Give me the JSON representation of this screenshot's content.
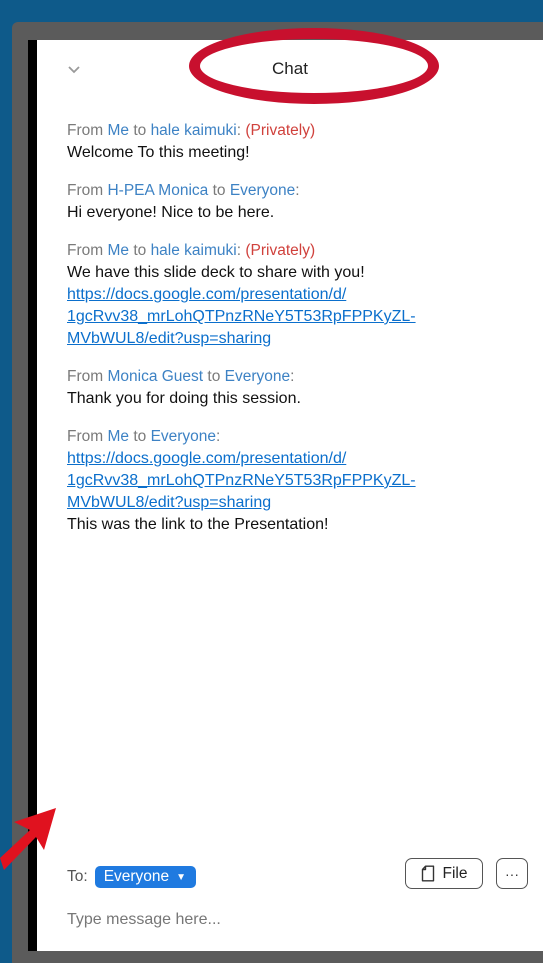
{
  "header": {
    "title": "Chat",
    "collapse_icon": "chevron-down-icon"
  },
  "messages": [
    {
      "from_prefix": "From ",
      "from": "Me",
      "to_prefix": " to ",
      "to": "hale kaimuki",
      "sep": ": ",
      "privacy": "(Privately)",
      "lines": [
        "Welcome To this meeting!"
      ],
      "links": []
    },
    {
      "from_prefix": "From ",
      "from": "H-PEA Monica",
      "to_prefix": " to ",
      "to": "Everyone",
      "sep": ":",
      "privacy": "",
      "lines": [
        "Hi everyone! Nice to be here."
      ],
      "links": []
    },
    {
      "from_prefix": "From ",
      "from": "Me",
      "to_prefix": " to ",
      "to": "hale kaimuki",
      "sep": ": ",
      "privacy": "(Privately)",
      "lines": [
        "We have this slide deck to share with you!"
      ],
      "links": [
        "https://docs.google.com/presentation/d/",
        "1gcRvv38_mrLohQTPnzRNeY5T53RpFPPKyZL-",
        "MVbWUL8/edit?usp=sharing"
      ]
    },
    {
      "from_prefix": "From ",
      "from": "Monica Guest",
      "to_prefix": " to ",
      "to": "Everyone",
      "sep": ":",
      "privacy": "",
      "lines": [
        "Thank you for doing this session."
      ],
      "links": []
    },
    {
      "from_prefix": "From ",
      "from": "Me",
      "to_prefix": " to ",
      "to": "Everyone",
      "sep": ":",
      "privacy": "",
      "lines_before": [],
      "links": [
        "https://docs.google.com/presentation/d/",
        "1gcRvv38_mrLohQTPnzRNeY5T53RpFPPKyZL-",
        "MVbWUL8/edit?usp=sharing"
      ],
      "lines_after": [
        "This was the link to the Presentation!"
      ]
    }
  ],
  "footer": {
    "to_label": "To:",
    "recipient": "Everyone",
    "file_label": "File",
    "more_label": "···",
    "input_placeholder": "Type message here..."
  },
  "colors": {
    "background": "#0e5a8a",
    "annotation_red": "#c8102e",
    "name_blue": "#3d82c4",
    "private_red": "#d0413c",
    "link_blue": "#0b6fcc",
    "select_blue": "#1f7ae0"
  }
}
